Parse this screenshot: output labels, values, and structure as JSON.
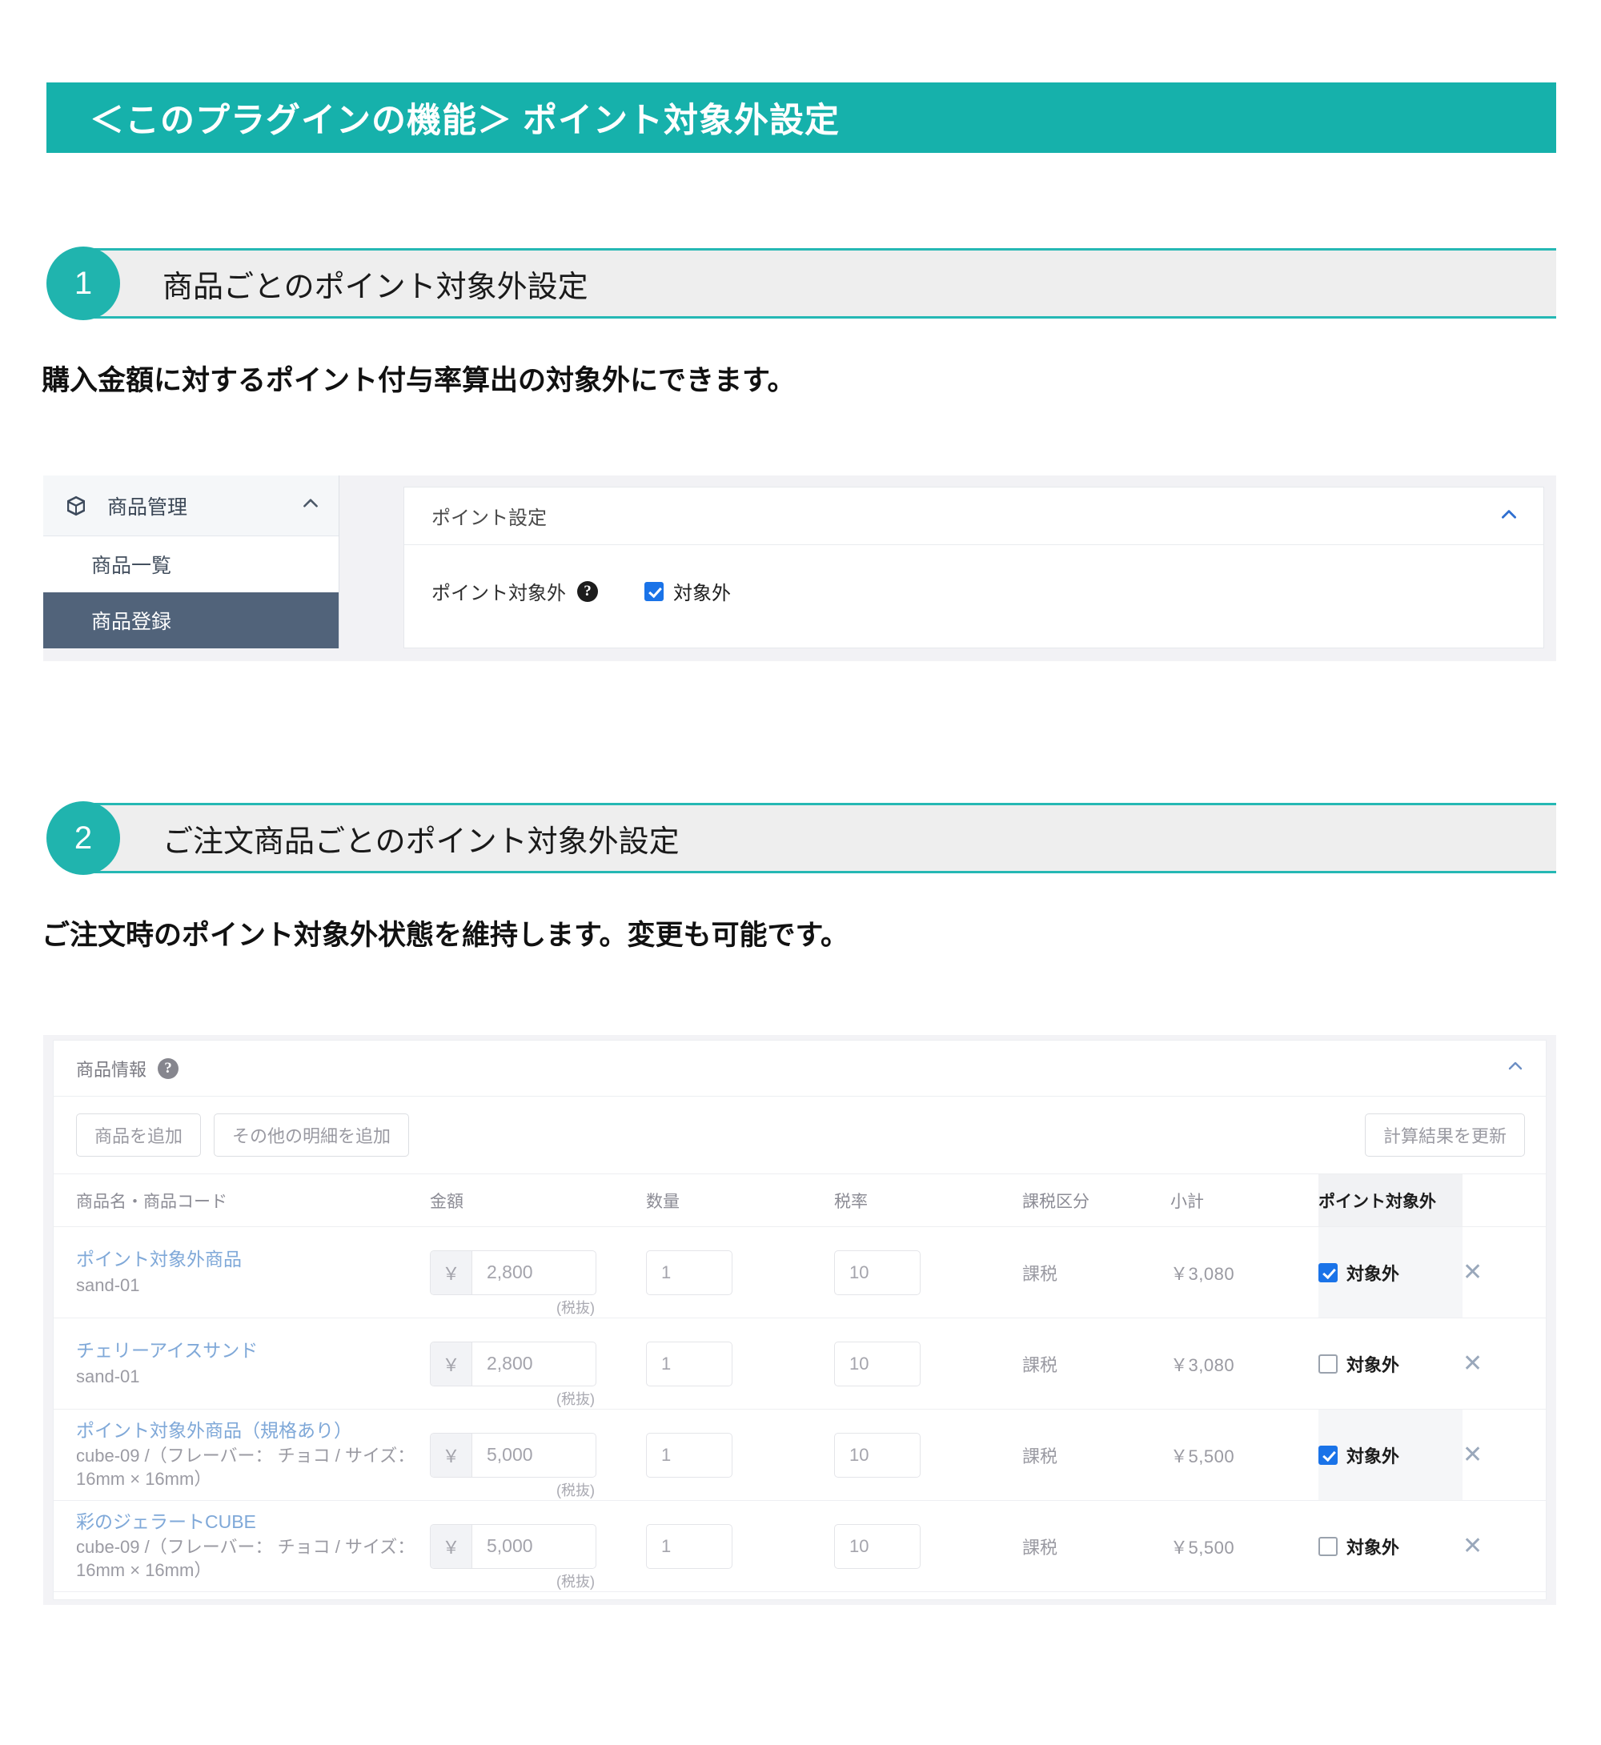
{
  "banner": {
    "title": "＜このプラグインの機能＞ ポイント対象外設定"
  },
  "sections": [
    {
      "number": "1",
      "heading": "商品ごとのポイント対象外設定",
      "description": "購入金額に対するポイント付与率算出の対象外にできます。"
    },
    {
      "number": "2",
      "heading": "ご注文商品ごとのポイント対象外設定",
      "description": "ご注文時のポイント対象外状態を維持します。変更も可能です。"
    }
  ],
  "sidebar": {
    "group_label": "商品管理",
    "group_icon": "cube-icon",
    "collapse_icon": "chevron-up-icon",
    "items": [
      {
        "label": "商品一覧",
        "active": false
      },
      {
        "label": "商品登録",
        "active": true
      }
    ]
  },
  "point_panel": {
    "title": "ポイント設定",
    "collapse_icon": "chevron-up-icon",
    "field_label": "ポイント対象外",
    "help_icon": "question-mark-icon",
    "checkbox_label": "対象外",
    "checkbox_checked": true
  },
  "order_panel": {
    "title": "商品情報",
    "help_icon": "question-mark-icon",
    "collapse_icon": "chevron-up-icon",
    "buttons": {
      "add_product": "商品を追加",
      "add_other_detail": "その他の明細を追加",
      "recalculate": "計算結果を更新"
    },
    "columns": [
      "商品名・商品コード",
      "金額",
      "数量",
      "税率",
      "課税区分",
      "小計",
      "ポイント対象外"
    ],
    "tax_note": "(税抜)",
    "currency_symbol": "￥",
    "delete_icon": "close-icon",
    "rows": [
      {
        "name": "ポイント対象外商品",
        "code": "sand-01",
        "price": "2,800",
        "qty": "1",
        "tax_rate": "10",
        "tax_class": "課税",
        "subtotal": "￥3,080",
        "point_label": "対象外",
        "point_excluded": true
      },
      {
        "name": "チェリーアイスサンド",
        "code": "sand-01",
        "price": "2,800",
        "qty": "1",
        "tax_rate": "10",
        "tax_class": "課税",
        "subtotal": "￥3,080",
        "point_label": "対象外",
        "point_excluded": false
      },
      {
        "name": "ポイント対象外商品（規格あり）",
        "code": "cube-09 /（フレーバー： チョコ / サイズ： 16mm × 16mm）",
        "price": "5,000",
        "qty": "1",
        "tax_rate": "10",
        "tax_class": "課税",
        "subtotal": "￥5,500",
        "point_label": "対象外",
        "point_excluded": true
      },
      {
        "name": "彩のジェラートCUBE",
        "code": "cube-09 /（フレーバー： チョコ / サイズ： 16mm × 16mm）",
        "price": "5,000",
        "qty": "1",
        "tax_rate": "10",
        "tax_class": "課税",
        "subtotal": "￥5,500",
        "point_label": "対象外",
        "point_excluded": false
      }
    ]
  },
  "colors": {
    "brand_teal": "#16b1ab",
    "accent_blue": "#1a73e8",
    "sidebar_active": "#51637a",
    "link_blue": "#7fa8d8"
  }
}
